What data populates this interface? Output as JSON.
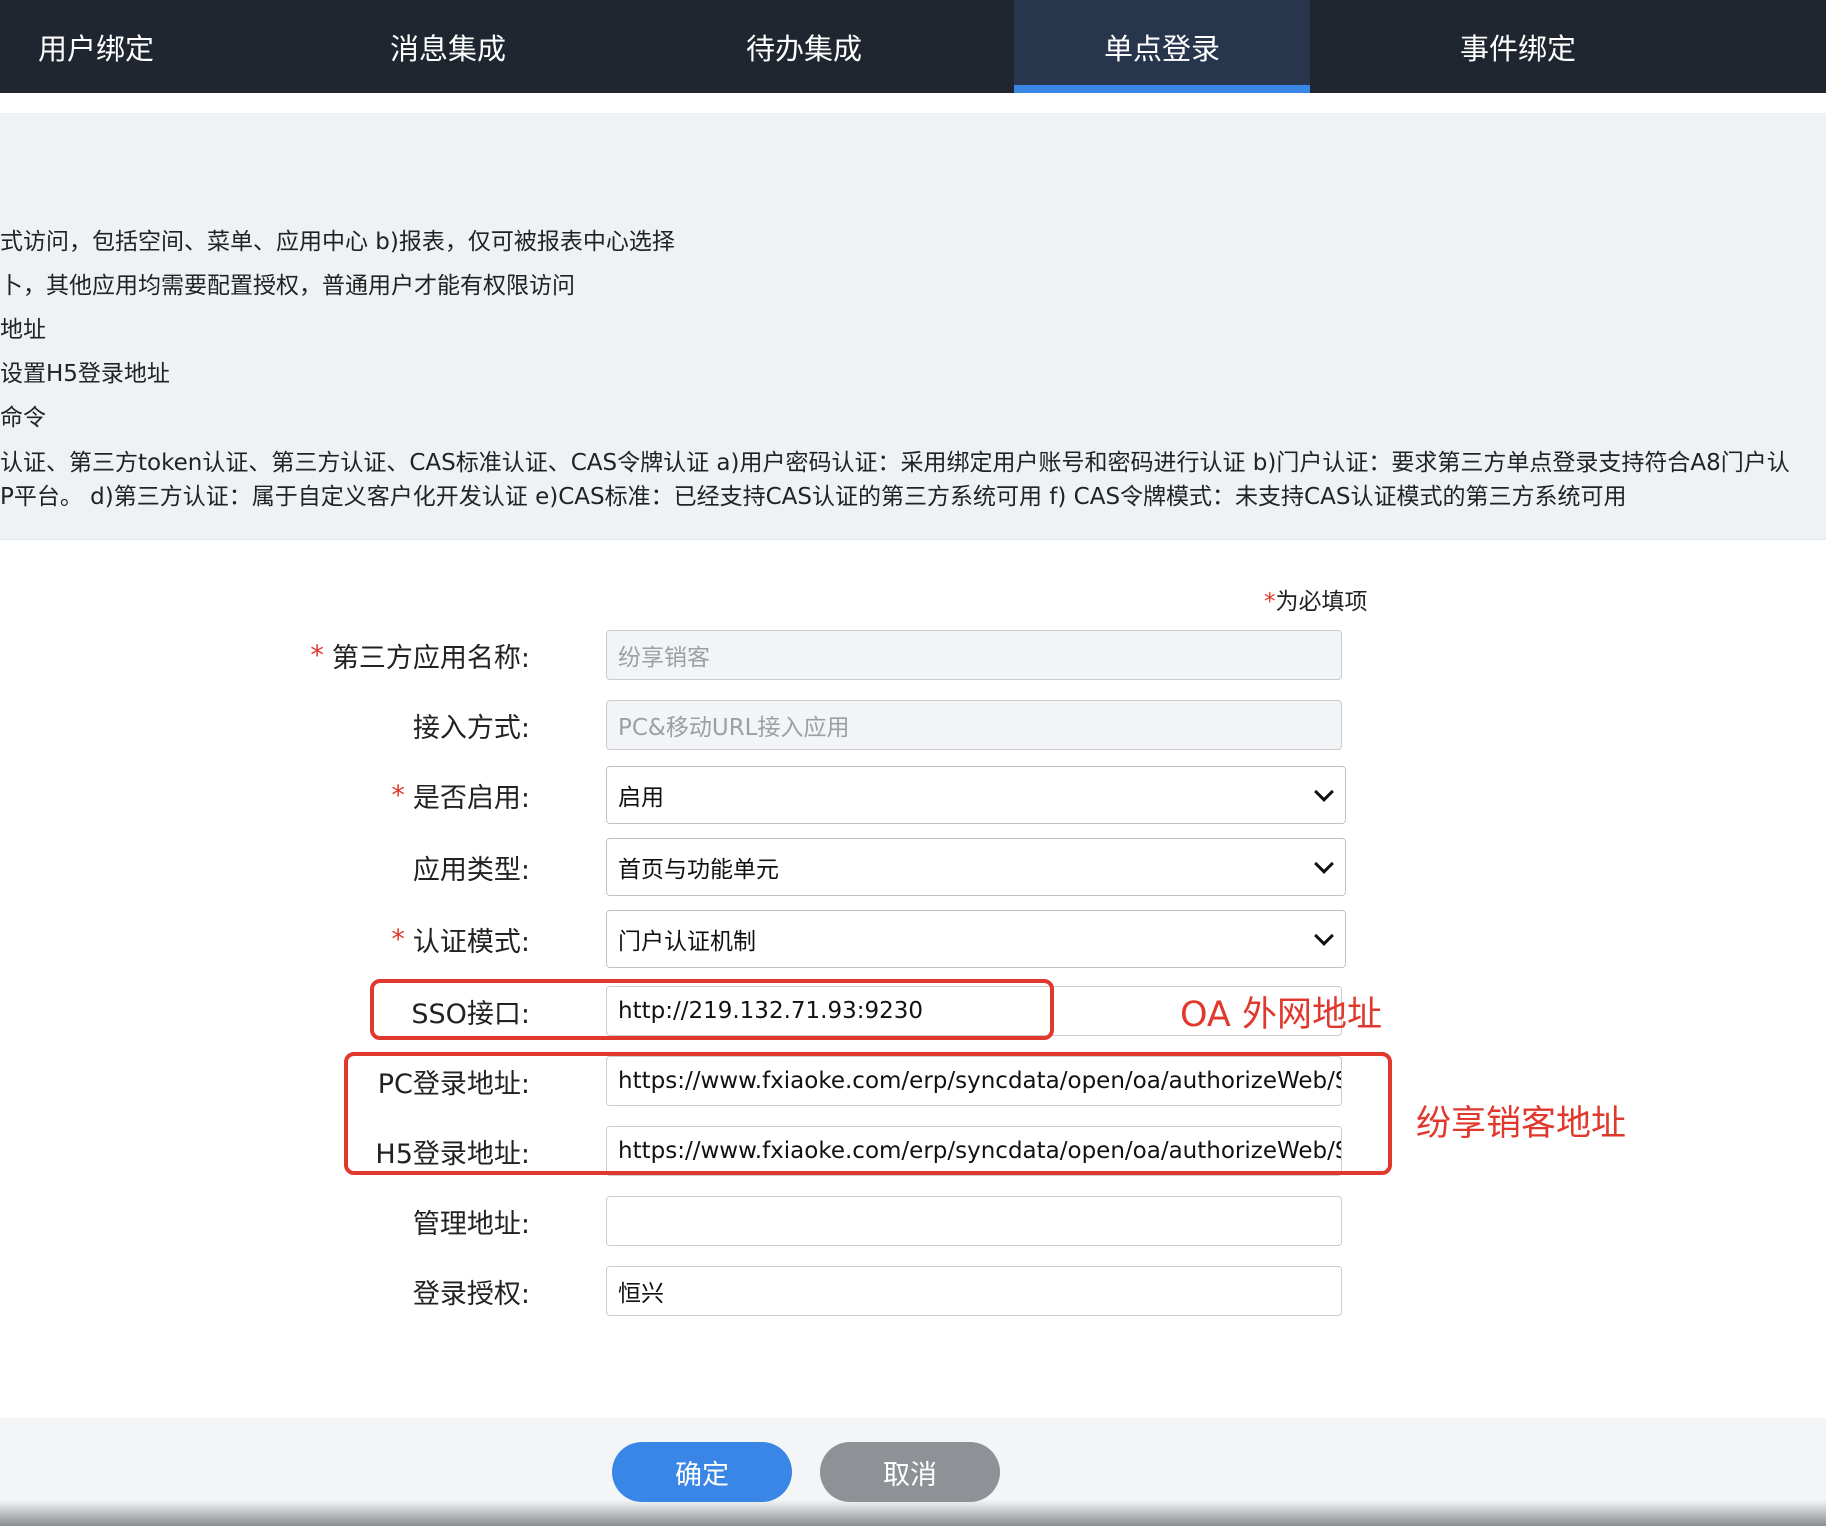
{
  "tabs": [
    {
      "label": "用户绑定"
    },
    {
      "label": "消息集成"
    },
    {
      "label": "待办集成"
    },
    {
      "label": "单点登录",
      "active": true
    },
    {
      "label": "事件绑定"
    }
  ],
  "notes": [
    "式访问，包括空间、菜单、应用中心 b)报表，仅可被报表中心选择",
    "卜，其他应用均需要配置授权，普通用户才能有权限访问",
    "地址",
    "设置H5登录地址",
    "命令",
    "认证、第三方token认证、第三方认证、CAS标准认证、CAS令牌认证 a)用户密码认证：采用绑定用户账号和密码进行认证 b)门户认证：要求第三方单点登录支持符合A8门户认",
    "P平台。 d)第三方认证：属于自定义客户化开发认证 e)CAS标准：已经支持CAS认证的第三方系统可用 f) CAS令牌模式：未支持CAS认证模式的第三方系统可用"
  ],
  "form": {
    "required_star": "*",
    "required_text": "为必填项",
    "app_name_label": "第三方应用名称:",
    "app_name_value": "纷享销客",
    "access_label": "接入方式:",
    "access_value": "PC&移动URL接入应用",
    "enabled_label": "是否启用:",
    "enabled_value": "启用",
    "app_type_label": "应用类型:",
    "app_type_value": "首页与功能单元",
    "auth_mode_label": "认证模式:",
    "auth_mode_value": "门户认证机制",
    "sso_label": "SSO接口:",
    "sso_value": "http://219.132.71.93:9230",
    "pc_login_label": "PC登录地址:",
    "pc_login_value": "https://www.fxiaoke.com/erp/syncdata/open/oa/authorizeWeb/SeeY",
    "h5_login_label": "H5登录地址:",
    "h5_login_value": "https://www.fxiaoke.com/erp/syncdata/open/oa/authorizeWeb/SeeY",
    "admin_url_label": "管理地址:",
    "admin_url_value": "",
    "login_auth_label": "登录授权:",
    "login_auth_value": "恒兴"
  },
  "annotations": {
    "oa_external": "OA 外网地址",
    "fxiaoke_address": "纷享销客地址"
  },
  "buttons": {
    "confirm": "确定",
    "cancel": "取消"
  },
  "colors": {
    "tab_bg": "#20262f",
    "tab_active_bg": "#27364c",
    "accent": "#3a86e6",
    "annotation_red": "#e0382c",
    "cancel_gray": "#8e9296"
  }
}
